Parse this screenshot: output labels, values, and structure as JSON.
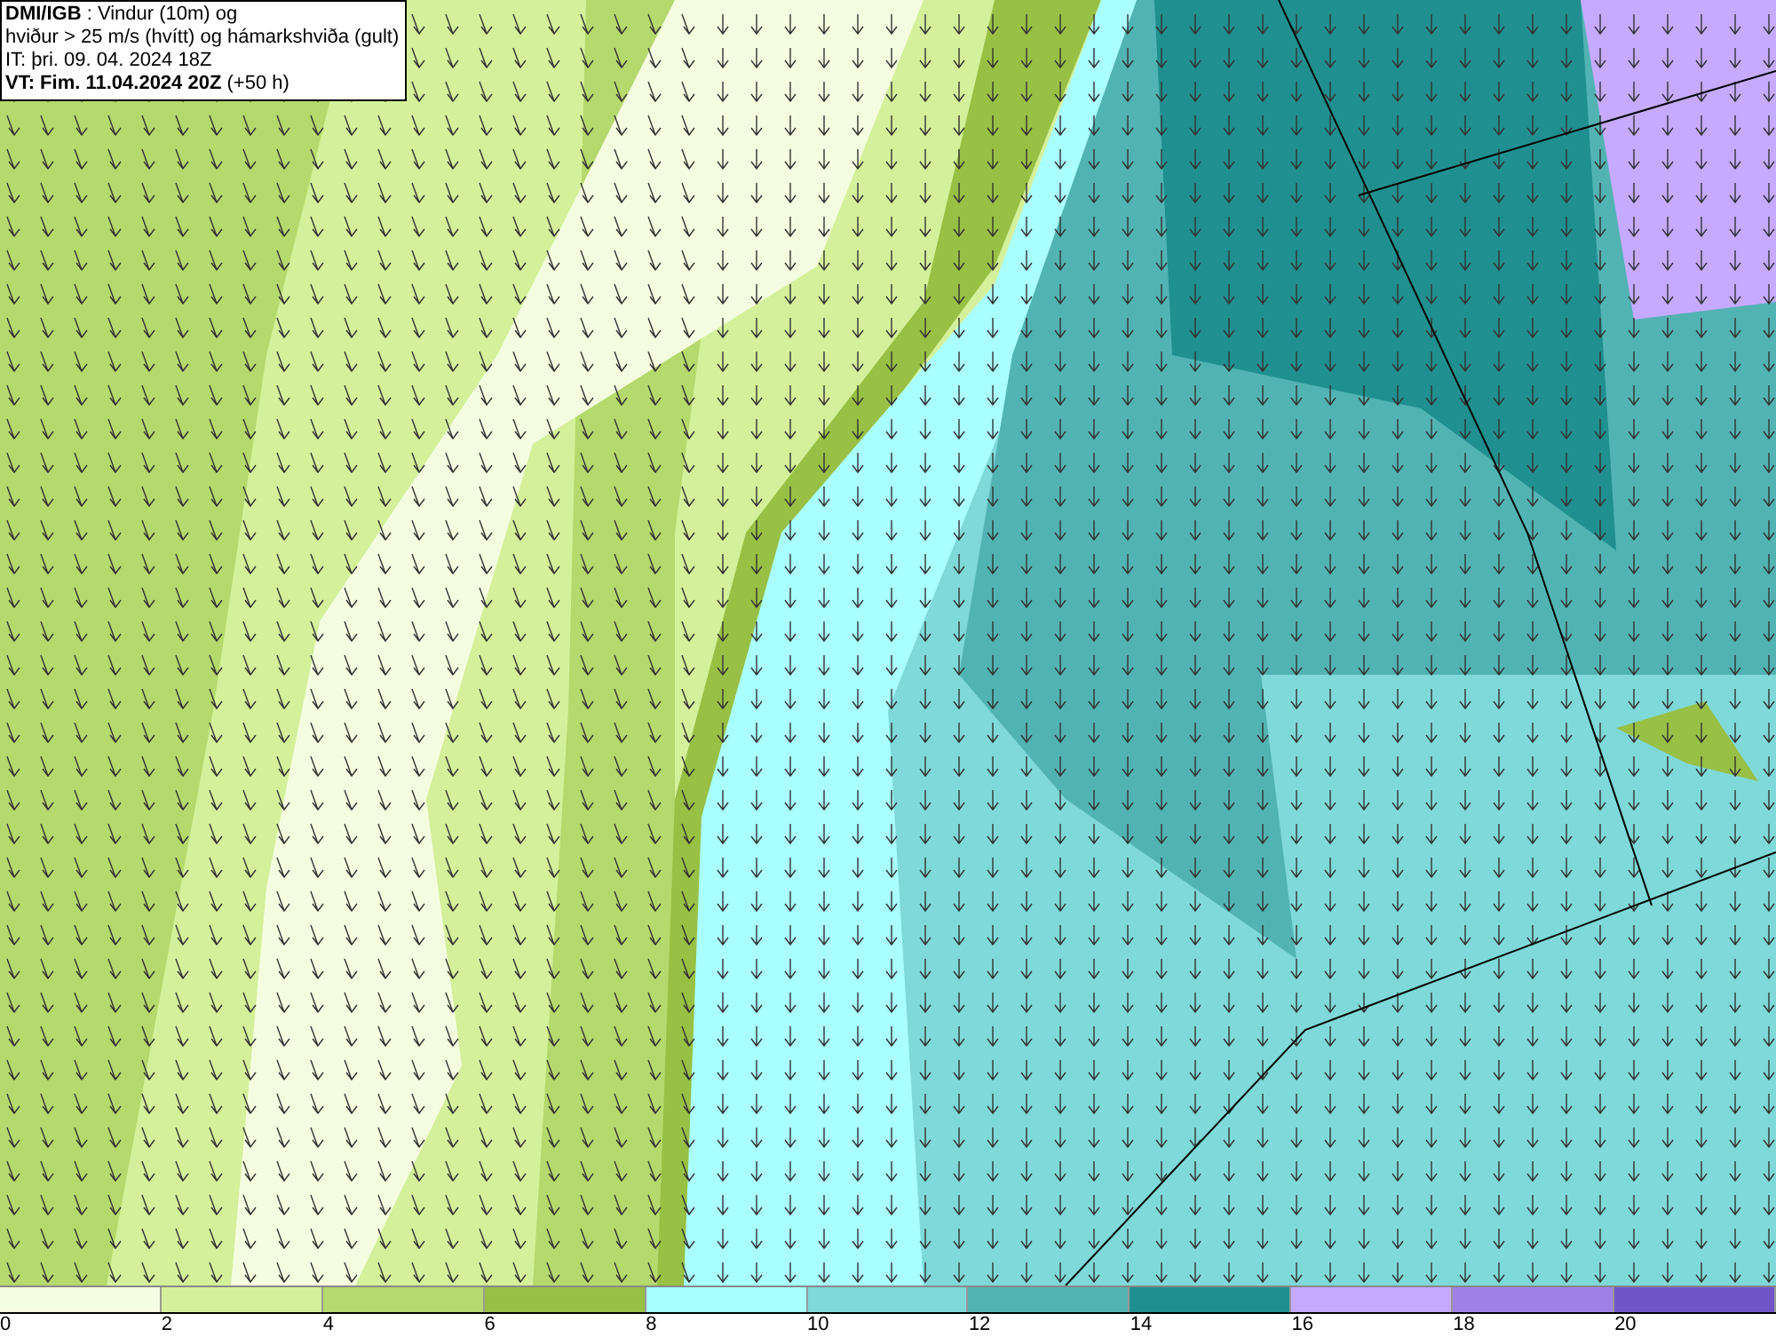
{
  "header": {
    "lines": [
      "**DMI/IGB** : Vindur (10m) og",
      "hviður > 25 m/s (hvítt) og hámarkshviða (gult)",
      "IT: þri. 09. 04. 2024 18Z",
      "**VT: Fim. 11.04.2024 20Z** (+50 h)"
    ]
  },
  "legend": {
    "swatches": [
      {
        "color": "#f5fde0"
      },
      {
        "color": "#d4f09a"
      },
      {
        "color": "#b5d96c"
      },
      {
        "color": "#98c044"
      },
      {
        "color": "#aaffff"
      },
      {
        "color": "#7fd9d9"
      },
      {
        "color": "#52b3b3"
      },
      {
        "color": "#208f8f"
      },
      {
        "color": "#c6aaff"
      },
      {
        "color": "#9f80e6"
      },
      {
        "color": "#7055c8"
      }
    ],
    "labels": [
      "0",
      "2",
      "4",
      "6",
      "8",
      "10",
      "12",
      "14",
      "16",
      "18",
      "20"
    ]
  }
}
